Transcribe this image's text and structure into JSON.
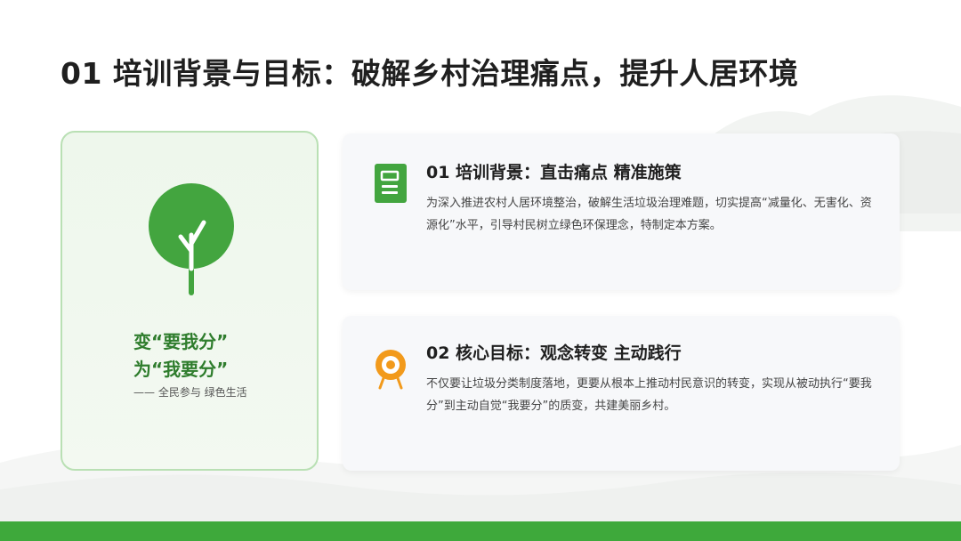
{
  "colors": {
    "accent_green": "#3ea93b",
    "dark_green_text": "#2f7d2d",
    "card_border": "#b9e0b4",
    "orange_icon": "#f29a1b"
  },
  "title": "01 培训背景与目标：破解乡村治理痛点，提升人居环境",
  "slogan": {
    "icon": "tree-icon",
    "line1": "变“要我分”",
    "line2": "为“我要分”",
    "sub": "—— 全民参与 绿色生活"
  },
  "cards": [
    {
      "icon": "document-icon",
      "heading": "01 培训背景：直击痛点 精准施策",
      "body": "为深入推进农村人居环境整治，破解生活垃圾治理难题，切实提高“减量化、无害化、资源化”水平，引导村民树立绿色环保理念，特制定本方案。"
    },
    {
      "icon": "target-icon",
      "heading": "02 核心目标：观念转变 主动践行",
      "body": "不仅要让垃圾分类制度落地，更要从根本上推动村民意识的转变，实现从被动执行“要我分”到主动自觉“我要分”的质变，共建美丽乡村。"
    }
  ]
}
